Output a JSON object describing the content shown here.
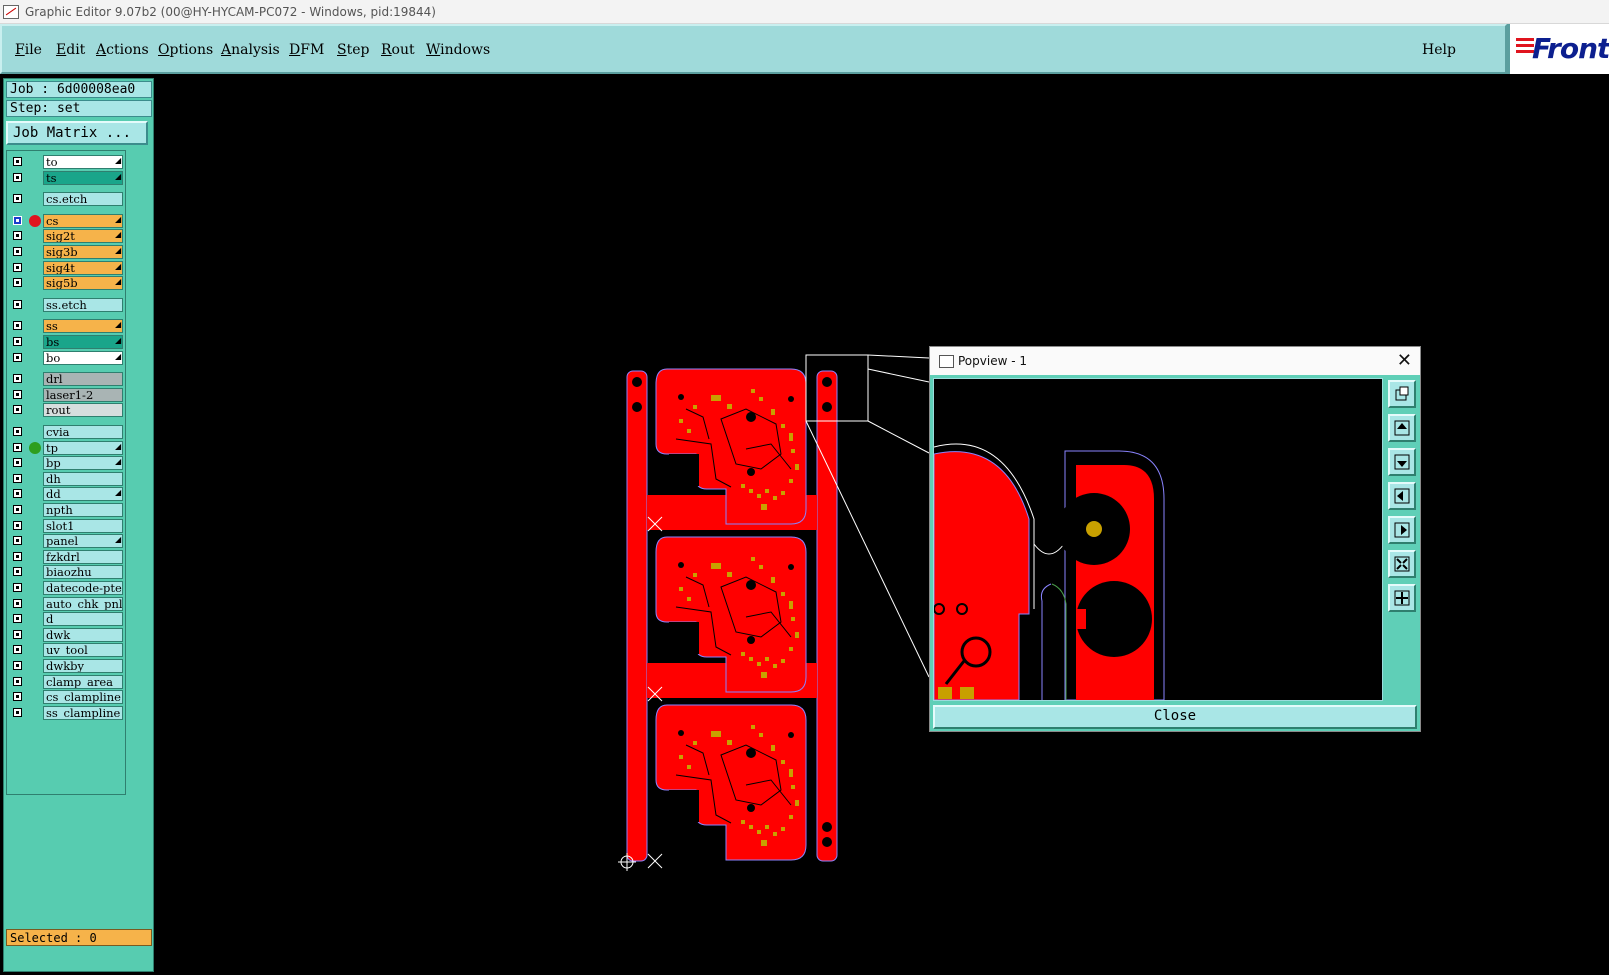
{
  "window": {
    "title": "Graphic Editor 9.07b2 (00@HY-HYCAM-PC072 - Windows, pid:19844)"
  },
  "menu": {
    "items": [
      "File",
      "Edit",
      "Actions",
      "Options",
      "Analysis",
      "DFM",
      "Step",
      "Rout",
      "Windows"
    ],
    "help": "Help"
  },
  "logo": {
    "text": "Front"
  },
  "panel": {
    "job": "Job : 6d00008ea0",
    "step": "Step: set",
    "job_matrix": "Job Matrix ...",
    "selected": "Selected : 0"
  },
  "layers": [
    {
      "name": "to",
      "color": "white",
      "arrow": true
    },
    {
      "name": "ts",
      "color": "teal",
      "arrow": true
    },
    {
      "name": "cs.etch",
      "color": "cyan",
      "arrow": false
    },
    {
      "name": "cs",
      "color": "orange",
      "arrow": true,
      "active": true,
      "dot": "#e0141e"
    },
    {
      "name": "sig2t",
      "color": "orange",
      "arrow": true
    },
    {
      "name": "sig3b",
      "color": "orange",
      "arrow": true
    },
    {
      "name": "sig4t",
      "color": "orange",
      "arrow": true
    },
    {
      "name": "sig5b",
      "color": "orange",
      "arrow": true
    },
    {
      "name": "ss.etch",
      "color": "cyan",
      "arrow": false
    },
    {
      "name": "ss",
      "color": "orange",
      "arrow": true
    },
    {
      "name": "bs",
      "color": "teal",
      "arrow": true
    },
    {
      "name": "bo",
      "color": "white",
      "arrow": true
    },
    {
      "name": "drl",
      "color": "gray",
      "arrow": false
    },
    {
      "name": "laser1-2",
      "color": "gray",
      "arrow": false
    },
    {
      "name": "rout",
      "color": "lgray",
      "arrow": false
    },
    {
      "name": "cvia",
      "color": "cyan",
      "arrow": false
    },
    {
      "name": "tp",
      "color": "cyan",
      "arrow": true,
      "dot": "#2e9e1e"
    },
    {
      "name": "bp",
      "color": "cyan",
      "arrow": true
    },
    {
      "name": "dh",
      "color": "cyan",
      "arrow": false
    },
    {
      "name": "dd",
      "color": "cyan",
      "arrow": true
    },
    {
      "name": "npth",
      "color": "cyan",
      "arrow": false
    },
    {
      "name": "slot1",
      "color": "cyan",
      "arrow": false
    },
    {
      "name": "panel",
      "color": "cyan",
      "arrow": true
    },
    {
      "name": "fzkdrl",
      "color": "cyan",
      "arrow": false
    },
    {
      "name": "biaozhu",
      "color": "cyan",
      "arrow": false
    },
    {
      "name": "datecode-pte",
      "color": "cyan",
      "arrow": false
    },
    {
      "name": "auto_chk_pnl",
      "color": "cyan",
      "arrow": false
    },
    {
      "name": "d",
      "color": "cyan",
      "arrow": false
    },
    {
      "name": "dwk",
      "color": "cyan",
      "arrow": false
    },
    {
      "name": "uv_tool",
      "color": "cyan",
      "arrow": false
    },
    {
      "name": "dwkby",
      "color": "cyan",
      "arrow": false
    },
    {
      "name": "clamp_area",
      "color": "cyan",
      "arrow": false
    },
    {
      "name": "cs_clampline",
      "color": "cyan",
      "arrow": false
    },
    {
      "name": "ss_clampline",
      "color": "cyan",
      "arrow": false
    }
  ],
  "popview": {
    "title": "Popview - 1",
    "close_label": "Close",
    "tools": [
      "zoom-window-icon",
      "pan-up-icon",
      "pan-down-icon",
      "pan-left-icon",
      "pan-right-icon",
      "zoom-out-icon",
      "zoom-in-icon"
    ]
  },
  "colors": {
    "copper": "#ff0000",
    "pad": "#c8a000",
    "menubar": "#9fdada",
    "panel": "#57ccb0"
  }
}
